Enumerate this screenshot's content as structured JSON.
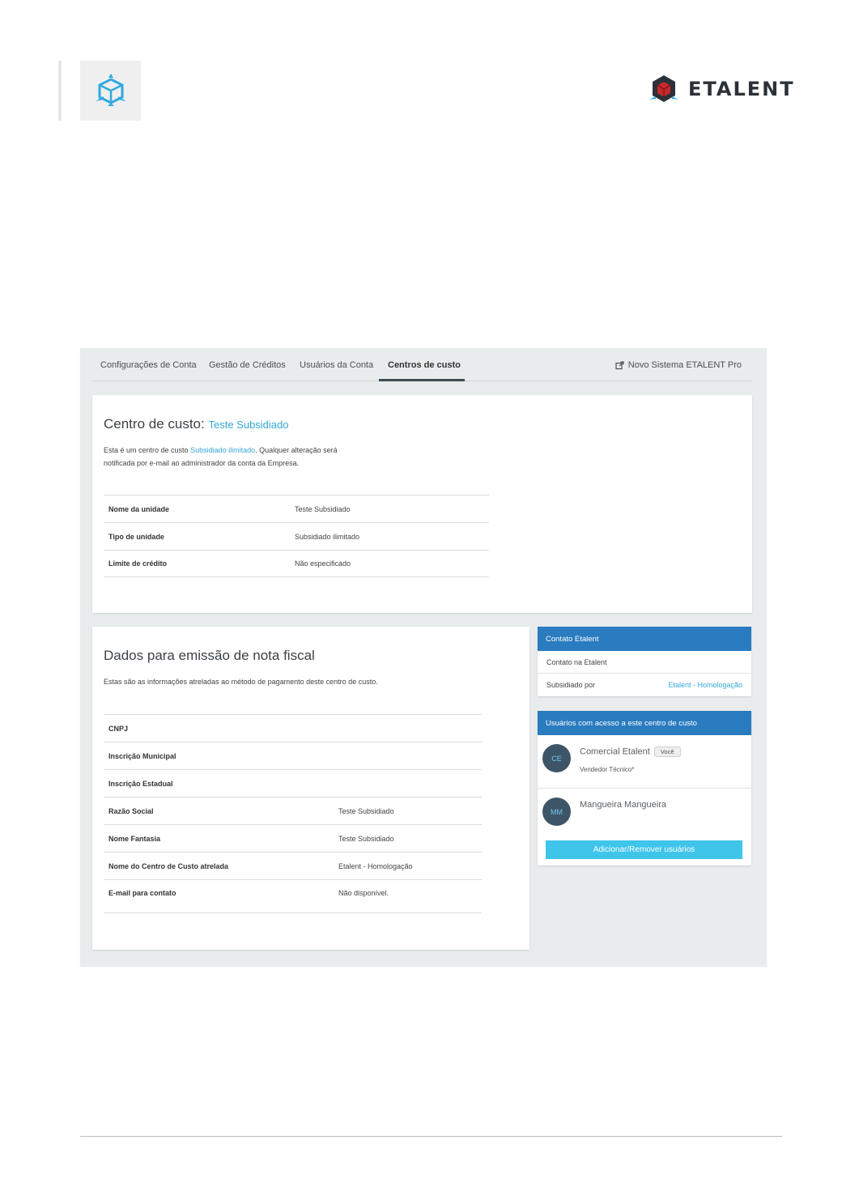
{
  "header": {
    "brand_name": "ETALENT",
    "logo_icon": "cube-logo-icon"
  },
  "tabs": [
    {
      "label": "Configurações de Conta",
      "active": false
    },
    {
      "label": "Gestão de Créditos",
      "active": false
    },
    {
      "label": "Usuários da Conta",
      "active": false
    },
    {
      "label": "Centros de custo",
      "active": true
    }
  ],
  "external_link": {
    "label": "Novo Sistema ETALENT Pro",
    "icon": "external-link-icon"
  },
  "cost_center": {
    "title_prefix": "Centro de custo:",
    "title_name": "Teste Subsidiado",
    "desc_part1": "Esta é um centro de custo ",
    "desc_link": "Subsidiado ilimitado",
    "desc_part2": ". Qualquer alteração será",
    "desc_line2": "notificada por e-mail ao administrador da conta da Empresa.",
    "rows": [
      {
        "key": "Nome da unidade",
        "value": "Teste Subsidiado"
      },
      {
        "key": "Tipo de unidade",
        "value": "Subsidiado ilimitado"
      },
      {
        "key": "Limite de crédito",
        "value": "Não especificado"
      }
    ]
  },
  "invoice": {
    "title": "Dados para emissão de nota fiscal",
    "description": "Estas são as informações atreladas ao método de pagamento deste centro de custo.",
    "rows": [
      {
        "key": "CNPJ",
        "value": ""
      },
      {
        "key": "Inscrição Municipal",
        "value": ""
      },
      {
        "key": "Inscrição Estadual",
        "value": ""
      },
      {
        "key": "Razão Social",
        "value": "Teste Subsidiado"
      },
      {
        "key": "Nome Fantasia",
        "value": "Teste Subsidiado"
      },
      {
        "key": "Nome do Centro de Custo atrelada",
        "value": "Etalent - Homologação"
      },
      {
        "key": "E-mail para contato",
        "value": "Não disponível."
      }
    ]
  },
  "contact_panel": {
    "title": "Contato Etalent",
    "row1_label": "Contato na Etalent",
    "row2_label": "Subsidiado por",
    "row2_value": "Etalent - Homologação"
  },
  "users_panel": {
    "title": "Usuários com acesso a este centro de custo",
    "users": [
      {
        "initials": "CE",
        "name": "Comercial Etalent",
        "badge": "Você",
        "role": "Vendedor Técnico*"
      },
      {
        "initials": "MM",
        "name": "Mangueira Mangueira",
        "badge": "",
        "role": ""
      }
    ],
    "button_label": "Adicionar/Remover usuários"
  },
  "colors": {
    "accent": "#35a7d7",
    "panel_header": "#2a7bbf",
    "button": "#3fc4ea",
    "frame_bg": "#e8ecec"
  }
}
